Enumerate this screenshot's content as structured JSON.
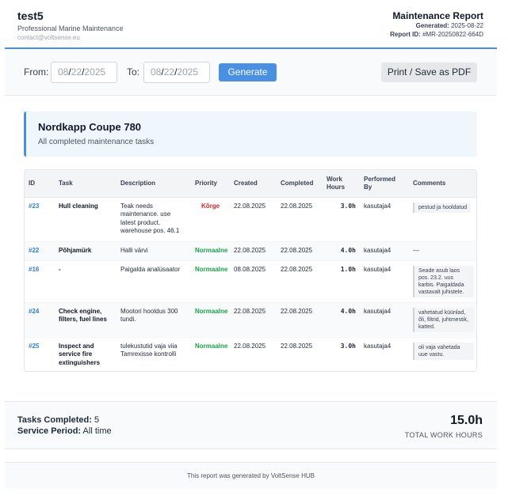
{
  "company": {
    "name": "test5",
    "tagline": "Professional Marine Maintenance",
    "contact": "contact@voltsense.eu"
  },
  "report": {
    "title": "Maintenance Report",
    "generated_label": "Generated:",
    "generated_value": "2025-08-22",
    "id_label": "Report ID:",
    "id_value": "#MR-20250822-664D"
  },
  "controls": {
    "from_label": "From:",
    "to_label": "To:",
    "from_date": {
      "mm": "08",
      "dd": "22",
      "yyyy": "2025"
    },
    "to_date": {
      "mm": "08",
      "dd": "22",
      "yyyy": "2025"
    },
    "generate_label": "Generate",
    "print_label": "Print / Save as PDF"
  },
  "vessel": {
    "name": "Nordkapp Coupe 780",
    "subtitle": "All completed maintenance tasks"
  },
  "table": {
    "headers": {
      "id": "ID",
      "task": "Task",
      "description": "Description",
      "priority": "Priority",
      "created": "Created",
      "completed": "Completed",
      "work_hours": "Work Hours",
      "performed_by": "Performed By",
      "comments": "Comments"
    },
    "rows": [
      {
        "id": "#23",
        "task": "Hull cleaning",
        "description": "Teak needs maintenance. use latest product. warehouse pos. 46.1",
        "priority": "Kõrge",
        "created": "22.08.2025",
        "completed": "22.08.2025",
        "hours": "3.0h",
        "performed_by": "kasutaja4",
        "comment": "pestud ja hooldatud"
      },
      {
        "id": "#22",
        "task": "Põhjamürk",
        "description": "Halli värvi",
        "priority": "Normaalne",
        "created": "22.08.2025",
        "completed": "22.08.2025",
        "hours": "4.0h",
        "performed_by": "kasutaja4",
        "comment": "—"
      },
      {
        "id": "#16",
        "task": "-",
        "description": "Paigalda analüsaator",
        "priority": "Normaalne",
        "created": "08.08.2025",
        "completed": "22.08.2025",
        "hours": "1.0h",
        "performed_by": "kasutaja4",
        "comment": "Seade asub laos pos. 23.2. uus karbis. Paigaldada vastavalt juhistele."
      },
      {
        "id": "#24",
        "task": "Check engine, filters, fuel lines",
        "description": "Mootori hooldus 300 tundi.",
        "priority": "Normaalne",
        "created": "22.08.2025",
        "completed": "22.08.2025",
        "hours": "4.0h",
        "performed_by": "kasutaja4",
        "comment": "vahetatud küünlad, õli, filtrid, juhtmestik, katted."
      },
      {
        "id": "#25",
        "task": "Inspect and service fire extinguishers",
        "description": "tulekustutid vaja viia Tamrexisse kontrolli",
        "priority": "Normaalne",
        "created": "22.08.2025",
        "completed": "22.08.2025",
        "hours": "3.0h",
        "performed_by": "kasutaja4",
        "comment": "oli vaja vahetada uue vastu."
      }
    ]
  },
  "summary": {
    "tasks_label": "Tasks Completed:",
    "tasks_value": "5",
    "period_label": "Service Period:",
    "period_value": "All time",
    "total_hours": "15.0h",
    "total_label": "TOTAL WORK HOURS"
  },
  "footer": {
    "text": "This report was generated by VoltSense HUB"
  },
  "colors": {
    "accent": "#4a90e2",
    "priority_high": "#dc2626",
    "priority_normal": "#16a34a",
    "id_link": "#2f80d1"
  }
}
